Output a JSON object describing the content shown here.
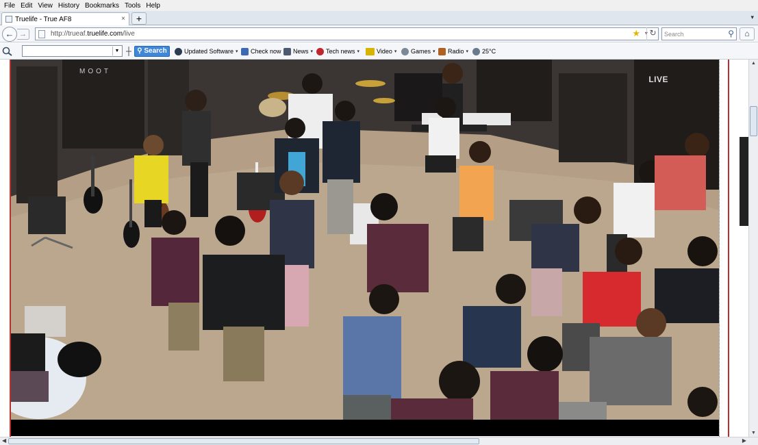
{
  "menu": [
    "File",
    "Edit",
    "View",
    "History",
    "Bookmarks",
    "Tools",
    "Help"
  ],
  "tab": {
    "title": "Truelife - True AF8",
    "close": "×"
  },
  "new_tab": "+",
  "tab_list": "▾",
  "nav": {
    "back": "←",
    "forward": "→",
    "url_prefix": "http://trueaf.",
    "url_domain": "truelife.com",
    "url_suffix": "/live",
    "bookmark_star": "★",
    "url_dropdown": "▾",
    "reload": "↻",
    "search_placeholder": "Search",
    "search_glyph": "⚲",
    "home": "⌂"
  },
  "toolbar": {
    "search_button": "Search",
    "items": [
      {
        "label": "Updated Software",
        "dropdown": "▾",
        "color": "#2a3b52"
      },
      {
        "label": "Check now",
        "dropdown": "",
        "color": "#3d6ab0"
      },
      {
        "label": "News",
        "dropdown": "▾",
        "color": "#4b5a6f"
      },
      {
        "label": "Tech news",
        "dropdown": "▾",
        "color": "#c0272d"
      },
      {
        "label": "Video",
        "dropdown": "▾",
        "color": "#d8b400"
      },
      {
        "label": "Games",
        "dropdown": "▾",
        "color": "#7b8896"
      },
      {
        "label": "Radio",
        "dropdown": "▾",
        "color": "#b06020"
      },
      {
        "label": "25°C",
        "dropdown": "",
        "color": "#6a7a8e"
      }
    ]
  },
  "video": {
    "live_label": "LIVE",
    "studio_sign": "MOOT"
  },
  "scroll": {
    "up": "▲",
    "down": "▼",
    "left": "◀",
    "right": "▶"
  }
}
